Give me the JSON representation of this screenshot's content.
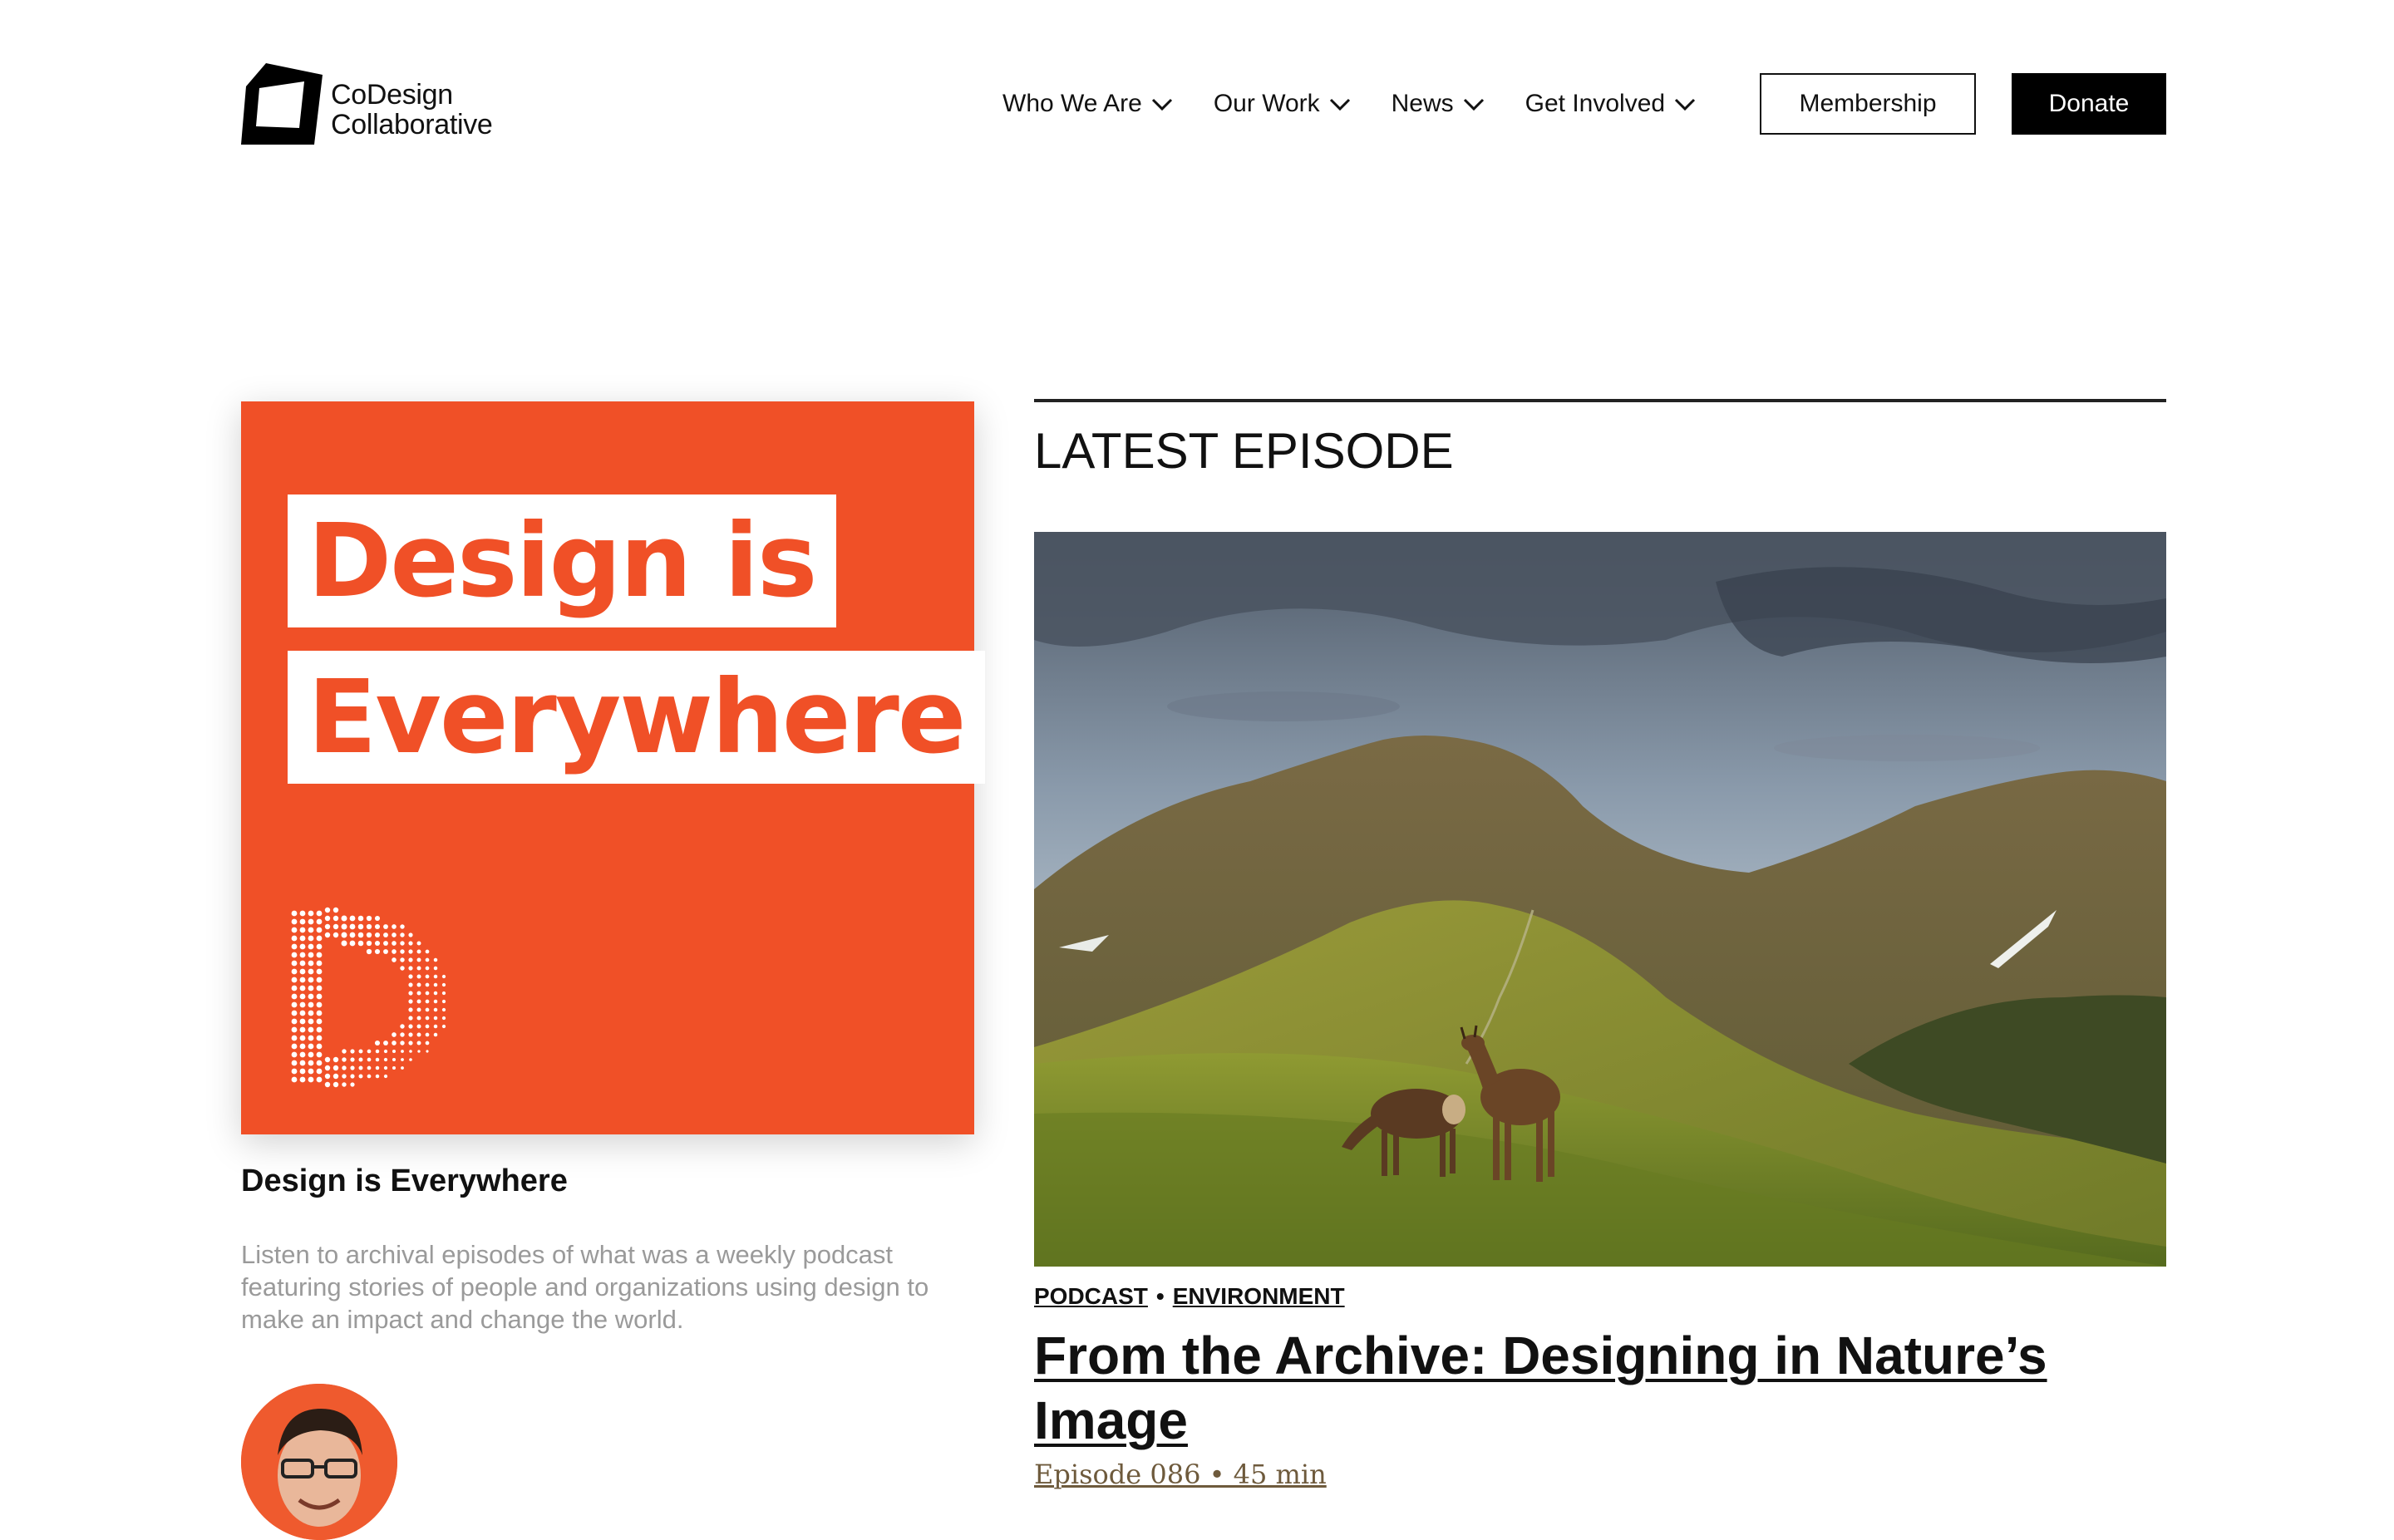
{
  "brand": {
    "line1": "CoDesign",
    "line2": "Collaborative"
  },
  "nav": {
    "items": [
      {
        "label": "Who We Are",
        "icon": "chevron-down-icon"
      },
      {
        "label": "Our Work",
        "icon": "chevron-down-icon"
      },
      {
        "label": "News",
        "icon": "chevron-down-icon"
      },
      {
        "label": "Get Involved",
        "icon": "chevron-down-icon"
      }
    ],
    "membership_label": "Membership",
    "donate_label": "Donate"
  },
  "podcast": {
    "cover_line1": "Design is",
    "cover_line2": "Everywhere",
    "title": "Design is Everywhere",
    "description": "Listen to archival episodes of what was a weekly podcast featuring stories of people and organizations using design to make an impact and change the world."
  },
  "latest": {
    "heading": "LATEST EPISODE",
    "tags": [
      "PODCAST",
      "ENVIRONMENT"
    ],
    "tag_separator": "•",
    "title": "From the Archive: Designing in Nature’s Image",
    "meta": "Episode 086 • 45 min"
  },
  "colors": {
    "accent": "#f05027",
    "ink": "#111111",
    "muted": "#9a9a9a"
  }
}
